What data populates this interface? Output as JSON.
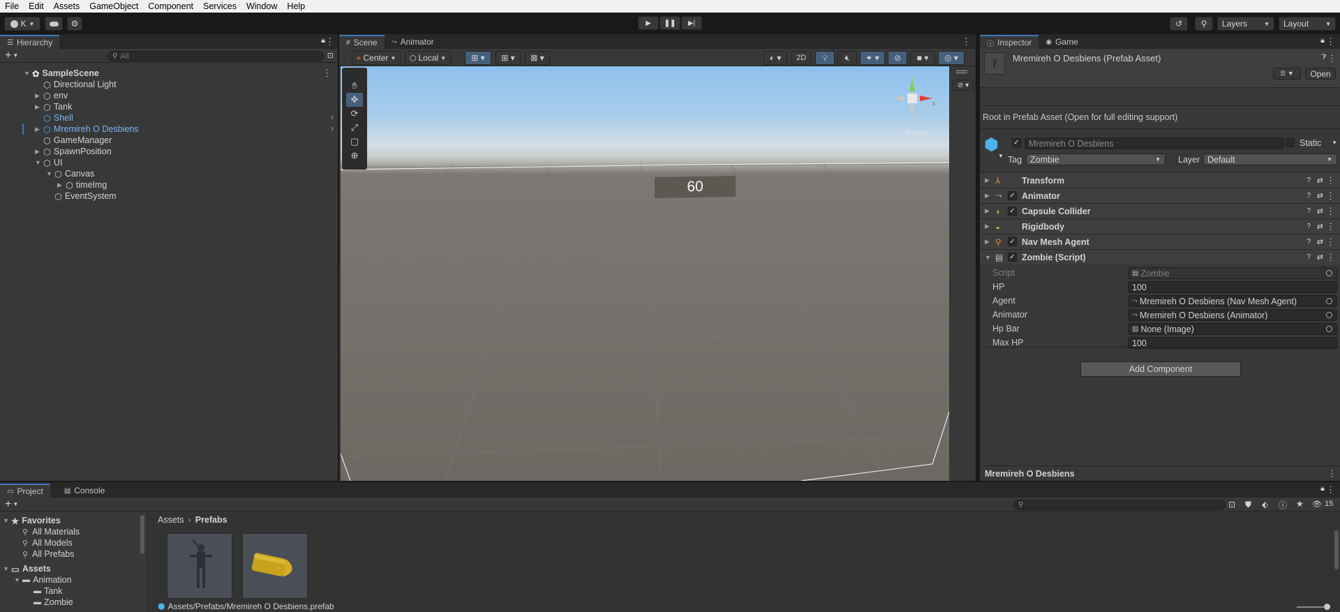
{
  "menubar": {
    "items": [
      "File",
      "Edit",
      "Assets",
      "GameObject",
      "Component",
      "Services",
      "Window",
      "Help"
    ]
  },
  "toolbar": {
    "account": "K",
    "layers": "Layers",
    "layout": "Layout"
  },
  "hierarchy": {
    "tab": "Hierarchy",
    "search_placeholder": "All",
    "scene": "SampleScene",
    "items": [
      {
        "label": "Directional Light",
        "indent": 1,
        "arrow": ""
      },
      {
        "label": "env",
        "indent": 1,
        "arrow": "▶"
      },
      {
        "label": "Tank",
        "indent": 1,
        "arrow": "▶"
      },
      {
        "label": "Shell",
        "indent": 1,
        "arrow": "",
        "prefab": true
      },
      {
        "label": "Mremireh O Desbiens",
        "indent": 1,
        "arrow": "▶",
        "prefab": true
      },
      {
        "label": "GameManager",
        "indent": 1,
        "arrow": ""
      },
      {
        "label": "SpawnPosition",
        "indent": 1,
        "arrow": "▶"
      },
      {
        "label": "UI",
        "indent": 1,
        "arrow": "▼"
      },
      {
        "label": "Canvas",
        "indent": 2,
        "arrow": "▼"
      },
      {
        "label": "timeImg",
        "indent": 3,
        "arrow": "▶"
      },
      {
        "label": "EventSystem",
        "indent": 2,
        "arrow": ""
      }
    ]
  },
  "scene": {
    "tabs": [
      "Scene",
      "Animator"
    ],
    "pivot": "Center",
    "space": "Local",
    "mode2d": "2D",
    "persp": "Persp",
    "timer": "60"
  },
  "inspector": {
    "tabs": [
      "Inspector",
      "Game"
    ],
    "asset_title": "Mremireh O Desbiens (Prefab Asset)",
    "open_button": "Open",
    "root_note": "Root in Prefab Asset (Open for full editing support)",
    "object_name": "Mremireh O Desbiens",
    "static_label": "Static",
    "tag_label": "Tag",
    "tag_value": "Zombie",
    "layer_label": "Layer",
    "layer_value": "Default",
    "components": [
      {
        "name": "Transform",
        "checkbox": false
      },
      {
        "name": "Animator",
        "checkbox": true
      },
      {
        "name": "Capsule Collider",
        "checkbox": true
      },
      {
        "name": "Rigidbody",
        "checkbox": false
      },
      {
        "name": "Nav Mesh Agent",
        "checkbox": true
      },
      {
        "name": "Zombie (Script)",
        "checkbox": true
      }
    ],
    "props": [
      {
        "label": "Script",
        "value": "Zombie"
      },
      {
        "label": "HP",
        "value": "100"
      },
      {
        "label": "Agent",
        "value": "Mremireh O Desbiens (Nav Mesh Agent)"
      },
      {
        "label": "Animator",
        "value": "Mremireh O Desbiens (Animator)"
      },
      {
        "label": "Hp Bar",
        "value": "None (Image)"
      },
      {
        "label": "Max HP",
        "value": "100"
      }
    ],
    "add_component": "Add Component",
    "footer": "Mremireh O Desbiens"
  },
  "project": {
    "tabs": [
      "Project",
      "Console"
    ],
    "badge": "15",
    "favorites": "Favorites",
    "fav_items": [
      "All Materials",
      "All Models",
      "All Prefabs"
    ],
    "assets": "Assets",
    "tree": [
      {
        "label": "Animation",
        "indent": 1
      },
      {
        "label": "Tank",
        "indent": 2
      },
      {
        "label": "Zombie",
        "indent": 2
      }
    ],
    "breadcrumb_root": "Assets",
    "breadcrumb_current": "Prefabs",
    "path": "Assets/Prefabs/Mremireh O Desbiens.prefab"
  },
  "colors": {
    "accent": "#3a79bb",
    "prefab_text": "#7cb3f2",
    "sky_top": "#7fb2e5",
    "ground": "#6e6863"
  }
}
